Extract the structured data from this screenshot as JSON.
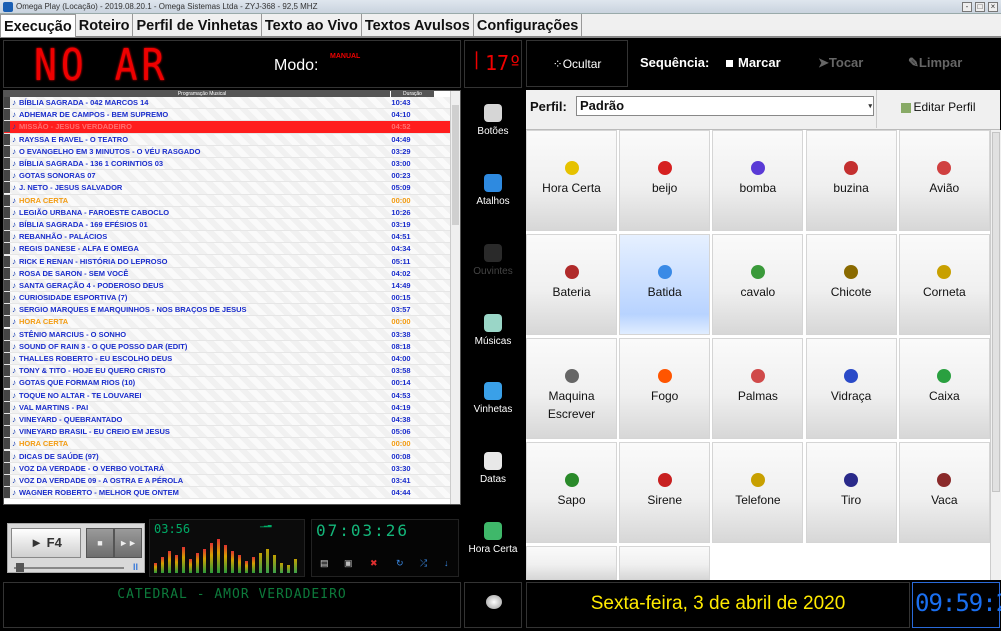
{
  "window": {
    "title": "Omega Play (Locação) - 2019.08.20.1 - Omega Sistemas Ltda - ZYJ-368 - 92,5 MHZ"
  },
  "menu": [
    "Execução",
    "Roteiro",
    "Perfil de Vinhetas",
    "Texto ao Vivo",
    "Textos Avulsos",
    "Configurações"
  ],
  "status": {
    "onair": "NO AR",
    "modo_label": "Modo:",
    "modo_value": "MANUAL",
    "temperature": "17º"
  },
  "playlist": {
    "col_title": "Programação Musical",
    "col_dur": "Duração",
    "rows": [
      {
        "t": "BÍBLIA SAGRADA - 042 MARCOS 14",
        "d": "10:43"
      },
      {
        "t": "ADHEMAR DE CAMPOS - BEM SUPREMO",
        "d": "04:10"
      },
      {
        "t": "MISSÃO - JESUS VERDADEIRO",
        "d": "04:52",
        "cur": true
      },
      {
        "t": "RAYSSA E RAVEL - O TEATRO",
        "d": "04:49"
      },
      {
        "t": "O EVANGELHO EM 3 MINUTOS - O VÉU RASGADO",
        "d": "03:29"
      },
      {
        "t": "BÍBLIA SAGRADA - 136 1 CORINTIOS 03",
        "d": "03:00"
      },
      {
        "t": "GOTAS SONORAS 07",
        "d": "00:23"
      },
      {
        "t": "J. NETO - JESUS SALVADOR",
        "d": "05:09"
      },
      {
        "t": "HORA CERTA",
        "d": "00:00",
        "hc": true
      },
      {
        "t": "LEGIÃO URBANA - FAROESTE CABOCLO",
        "d": "10:26"
      },
      {
        "t": "BÍBLIA SAGRADA - 169 EFÉSIOS 01",
        "d": "03:19"
      },
      {
        "t": "REBANHÃO - PALÁCIOS",
        "d": "04:51"
      },
      {
        "t": "REGIS DANESE - ALFA E OMEGA",
        "d": "04:34"
      },
      {
        "t": "RICK E RENAN - HISTÓRIA DO LEPROSO",
        "d": "05:11"
      },
      {
        "t": "ROSA DE SARON - SEM VOCÊ",
        "d": "04:02"
      },
      {
        "t": "SANTA GERAÇÃO 4 - PODEROSO DEUS",
        "d": "14:49"
      },
      {
        "t": "CURIOSIDADE ESPORTIVA (7)",
        "d": "00:15"
      },
      {
        "t": "SERGIO MARQUES E MARQUINHOS - NOS BRAÇOS DE JESUS",
        "d": "03:57"
      },
      {
        "t": "HORA CERTA",
        "d": "00:00",
        "hc": true
      },
      {
        "t": "STÊNIO MARCIUS - O SONHO",
        "d": "03:38"
      },
      {
        "t": "SOUND OF RAIN 3 - O QUE POSSO DAR (EDIT)",
        "d": "08:18"
      },
      {
        "t": "THALLES ROBERTO - EU ESCOLHO DEUS",
        "d": "04:00"
      },
      {
        "t": "TONY & TITO - HOJE EU QUERO CRISTO",
        "d": "03:58"
      },
      {
        "t": "GOTAS QUE FORMAM RIOS (10)",
        "d": "00:14"
      },
      {
        "t": "TOQUE NO ALTAR - TE LOUVAREI",
        "d": "04:53"
      },
      {
        "t": "VAL MARTINS - PAI",
        "d": "04:19"
      },
      {
        "t": "VINEYARD - QUEBRANTADO",
        "d": "04:38"
      },
      {
        "t": "VINEYARD BRASIL - EU CREIO EM JESUS",
        "d": "05:06"
      },
      {
        "t": "HORA CERTA",
        "d": "00:00",
        "hc": true
      },
      {
        "t": "DICAS DE SAÚDE (97)",
        "d": "00:08"
      },
      {
        "t": "VOZ DA VERDADE - O VERBO VOLTARÁ",
        "d": "03:30"
      },
      {
        "t": "VOZ DA VERDADE 09 - A OSTRA E A PÉROLA",
        "d": "03:41"
      },
      {
        "t": "WAGNER ROBERTO - MELHOR QUE ONTEM",
        "d": "04:44"
      }
    ]
  },
  "player": {
    "f4": "F4",
    "elapsed": "03:56",
    "clock": "07:03:26",
    "now_playing": "CATEDRAL - AMOR VERDADEIRO"
  },
  "side": [
    {
      "label": "Botões",
      "disabled": false,
      "color": "#d6d6d6"
    },
    {
      "label": "Atalhos",
      "disabled": false,
      "color": "#2e8ae0"
    },
    {
      "label": "Ouvintes",
      "disabled": true,
      "color": "#2a2a2a"
    },
    {
      "label": "Músicas",
      "disabled": false,
      "color": "#9ad6c7"
    },
    {
      "label": "Vinhetas",
      "disabled": false,
      "color": "#3aa0e8"
    },
    {
      "label": "Datas",
      "disabled": false,
      "color": "#e8e8e8"
    },
    {
      "label": "Hora Certa",
      "disabled": false,
      "color": "#3fb86a"
    }
  ],
  "controls": {
    "ocultar": "Ocultar",
    "sequencia": "Sequência:",
    "marcar": "Marcar",
    "tocar": "Tocar",
    "limpar": "Limpar"
  },
  "perfil": {
    "label": "Perfil:",
    "value": "Padrão",
    "edit": "Editar Perfil"
  },
  "tiles": [
    {
      "label": "Hora Certa",
      "color": "#e6c200"
    },
    {
      "label": "beijo",
      "color": "#d62020"
    },
    {
      "label": "bomba",
      "color": "#5a3ad6"
    },
    {
      "label": "buzina",
      "color": "#c43030"
    },
    {
      "label": "Avião",
      "color": "#d04040"
    },
    {
      "label": "Bateria",
      "color": "#b02a2a"
    },
    {
      "label": "Batida",
      "color": "#3a8ae6",
      "sel": true
    },
    {
      "label": "cavalo",
      "color": "#3a9a3a"
    },
    {
      "label": "Chicote",
      "color": "#8a6a00"
    },
    {
      "label": "Corneta",
      "color": "#c8a000"
    },
    {
      "label": "Maquina\nEscrever",
      "color": "#666"
    },
    {
      "label": "Fogo",
      "color": "#ff5500"
    },
    {
      "label": "Palmas",
      "color": "#d04a4a"
    },
    {
      "label": "Vidraça",
      "color": "#2a4ac8"
    },
    {
      "label": "Caixa",
      "color": "#2aa040"
    },
    {
      "label": "Sapo",
      "color": "#2a8a2a"
    },
    {
      "label": "Sirene",
      "color": "#c82020"
    },
    {
      "label": "Telefone",
      "color": "#c8a000"
    },
    {
      "label": "Tiro",
      "color": "#2a2a8a"
    },
    {
      "label": "Vaca",
      "color": "#8a2a2a"
    }
  ],
  "footer": {
    "date": "Sexta-feira, 3 de abril de 2020",
    "time": "09:59:26"
  }
}
